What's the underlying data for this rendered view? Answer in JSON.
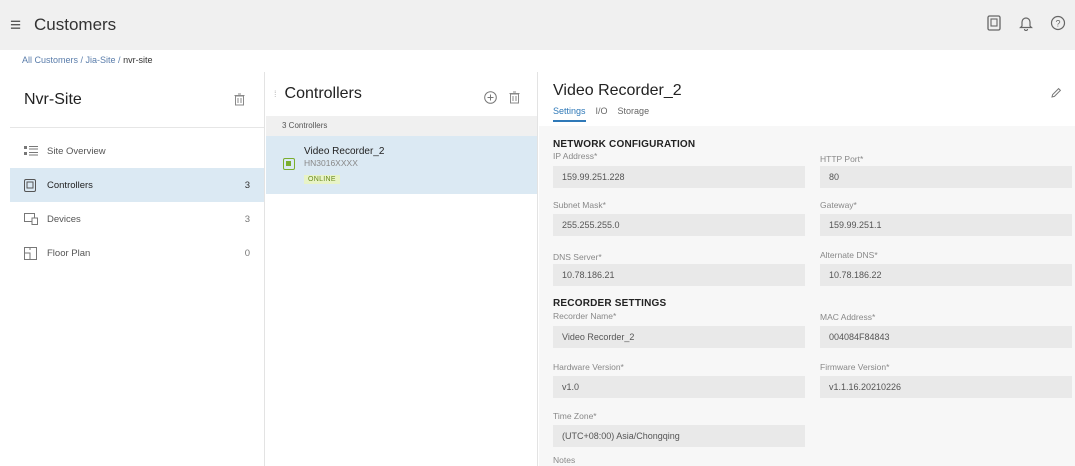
{
  "header": {
    "menu_icon": "hamburger-icon",
    "title": "Customers"
  },
  "breadcrumb": {
    "items": [
      "All Customers",
      "Jia-Site"
    ],
    "separator": " / ",
    "current": "nvr-site"
  },
  "site": {
    "name": "Nvr-Site",
    "nav": [
      {
        "label": "Site Overview",
        "count": ""
      },
      {
        "label": "Controllers",
        "count": "3"
      },
      {
        "label": "Devices",
        "count": "3"
      },
      {
        "label": "Floor Plan",
        "count": "0"
      }
    ]
  },
  "controllers": {
    "title": "Controllers",
    "count_label": "3 Controllers",
    "items": [
      {
        "name": "Video Recorder_2",
        "serial": "HN3016XXXX",
        "status": "ONLINE"
      }
    ]
  },
  "detail": {
    "title": "Video Recorder_2",
    "tabs": [
      "Settings",
      "I/O",
      "Storage"
    ],
    "network_section": "NETWORK CONFIGURATION",
    "recorder_section": "RECORDER SETTINGS",
    "fields": {
      "ip_label": "IP Address*",
      "ip_value": "159.99.251.228",
      "http_label": "HTTP Port*",
      "http_value": "80",
      "subnet_label": "Subnet Mask*",
      "subnet_value": "255.255.255.0",
      "gateway_label": "Gateway*",
      "gateway_value": "159.99.251.1",
      "dns_label": "DNS Server*",
      "dns_value": "10.78.186.21",
      "alt_dns_label": "Alternate DNS*",
      "alt_dns_value": "10.78.186.22",
      "name_label": "Recorder Name*",
      "name_value": "Video Recorder_2",
      "mac_label": "MAC Address*",
      "mac_value": "004084F84843",
      "hw_label": "Hardware Version*",
      "hw_value": "v1.0",
      "fw_label": "Firmware Version*",
      "fw_value": "v1.1.16.20210226",
      "tz_label": "Time Zone*",
      "tz_value": "(UTC+08:00) Asia/Chongqing",
      "notes_label": "Notes"
    }
  },
  "colors": {
    "accent": "#2f79b8",
    "selected_bg": "#dbe9f3",
    "online": "#7aae2d"
  }
}
